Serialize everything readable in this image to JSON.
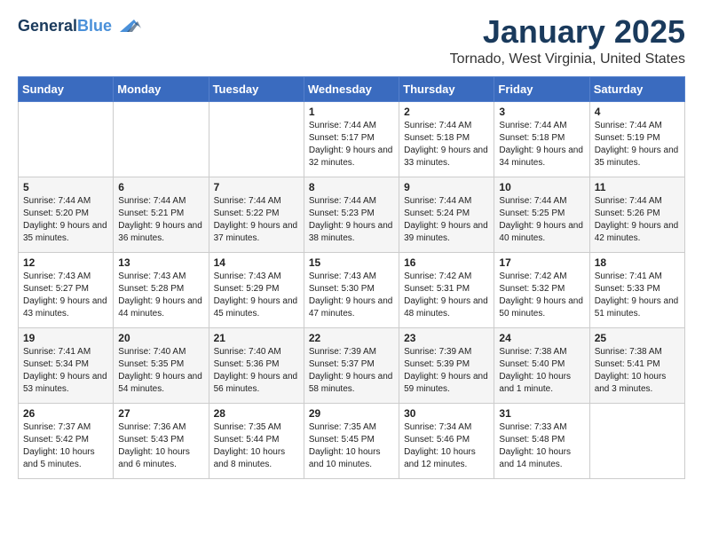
{
  "header": {
    "logo_line1": "General",
    "logo_line2": "Blue",
    "month": "January 2025",
    "location": "Tornado, West Virginia, United States"
  },
  "weekdays": [
    "Sunday",
    "Monday",
    "Tuesday",
    "Wednesday",
    "Thursday",
    "Friday",
    "Saturday"
  ],
  "weeks": [
    [
      {
        "day": "",
        "info": ""
      },
      {
        "day": "",
        "info": ""
      },
      {
        "day": "",
        "info": ""
      },
      {
        "day": "1",
        "info": "Sunrise: 7:44 AM\nSunset: 5:17 PM\nDaylight: 9 hours and 32 minutes."
      },
      {
        "day": "2",
        "info": "Sunrise: 7:44 AM\nSunset: 5:18 PM\nDaylight: 9 hours and 33 minutes."
      },
      {
        "day": "3",
        "info": "Sunrise: 7:44 AM\nSunset: 5:18 PM\nDaylight: 9 hours and 34 minutes."
      },
      {
        "day": "4",
        "info": "Sunrise: 7:44 AM\nSunset: 5:19 PM\nDaylight: 9 hours and 35 minutes."
      }
    ],
    [
      {
        "day": "5",
        "info": "Sunrise: 7:44 AM\nSunset: 5:20 PM\nDaylight: 9 hours and 35 minutes."
      },
      {
        "day": "6",
        "info": "Sunrise: 7:44 AM\nSunset: 5:21 PM\nDaylight: 9 hours and 36 minutes."
      },
      {
        "day": "7",
        "info": "Sunrise: 7:44 AM\nSunset: 5:22 PM\nDaylight: 9 hours and 37 minutes."
      },
      {
        "day": "8",
        "info": "Sunrise: 7:44 AM\nSunset: 5:23 PM\nDaylight: 9 hours and 38 minutes."
      },
      {
        "day": "9",
        "info": "Sunrise: 7:44 AM\nSunset: 5:24 PM\nDaylight: 9 hours and 39 minutes."
      },
      {
        "day": "10",
        "info": "Sunrise: 7:44 AM\nSunset: 5:25 PM\nDaylight: 9 hours and 40 minutes."
      },
      {
        "day": "11",
        "info": "Sunrise: 7:44 AM\nSunset: 5:26 PM\nDaylight: 9 hours and 42 minutes."
      }
    ],
    [
      {
        "day": "12",
        "info": "Sunrise: 7:43 AM\nSunset: 5:27 PM\nDaylight: 9 hours and 43 minutes."
      },
      {
        "day": "13",
        "info": "Sunrise: 7:43 AM\nSunset: 5:28 PM\nDaylight: 9 hours and 44 minutes."
      },
      {
        "day": "14",
        "info": "Sunrise: 7:43 AM\nSunset: 5:29 PM\nDaylight: 9 hours and 45 minutes."
      },
      {
        "day": "15",
        "info": "Sunrise: 7:43 AM\nSunset: 5:30 PM\nDaylight: 9 hours and 47 minutes."
      },
      {
        "day": "16",
        "info": "Sunrise: 7:42 AM\nSunset: 5:31 PM\nDaylight: 9 hours and 48 minutes."
      },
      {
        "day": "17",
        "info": "Sunrise: 7:42 AM\nSunset: 5:32 PM\nDaylight: 9 hours and 50 minutes."
      },
      {
        "day": "18",
        "info": "Sunrise: 7:41 AM\nSunset: 5:33 PM\nDaylight: 9 hours and 51 minutes."
      }
    ],
    [
      {
        "day": "19",
        "info": "Sunrise: 7:41 AM\nSunset: 5:34 PM\nDaylight: 9 hours and 53 minutes."
      },
      {
        "day": "20",
        "info": "Sunrise: 7:40 AM\nSunset: 5:35 PM\nDaylight: 9 hours and 54 minutes."
      },
      {
        "day": "21",
        "info": "Sunrise: 7:40 AM\nSunset: 5:36 PM\nDaylight: 9 hours and 56 minutes."
      },
      {
        "day": "22",
        "info": "Sunrise: 7:39 AM\nSunset: 5:37 PM\nDaylight: 9 hours and 58 minutes."
      },
      {
        "day": "23",
        "info": "Sunrise: 7:39 AM\nSunset: 5:39 PM\nDaylight: 9 hours and 59 minutes."
      },
      {
        "day": "24",
        "info": "Sunrise: 7:38 AM\nSunset: 5:40 PM\nDaylight: 10 hours and 1 minute."
      },
      {
        "day": "25",
        "info": "Sunrise: 7:38 AM\nSunset: 5:41 PM\nDaylight: 10 hours and 3 minutes."
      }
    ],
    [
      {
        "day": "26",
        "info": "Sunrise: 7:37 AM\nSunset: 5:42 PM\nDaylight: 10 hours and 5 minutes."
      },
      {
        "day": "27",
        "info": "Sunrise: 7:36 AM\nSunset: 5:43 PM\nDaylight: 10 hours and 6 minutes."
      },
      {
        "day": "28",
        "info": "Sunrise: 7:35 AM\nSunset: 5:44 PM\nDaylight: 10 hours and 8 minutes."
      },
      {
        "day": "29",
        "info": "Sunrise: 7:35 AM\nSunset: 5:45 PM\nDaylight: 10 hours and 10 minutes."
      },
      {
        "day": "30",
        "info": "Sunrise: 7:34 AM\nSunset: 5:46 PM\nDaylight: 10 hours and 12 minutes."
      },
      {
        "day": "31",
        "info": "Sunrise: 7:33 AM\nSunset: 5:48 PM\nDaylight: 10 hours and 14 minutes."
      },
      {
        "day": "",
        "info": ""
      }
    ]
  ]
}
